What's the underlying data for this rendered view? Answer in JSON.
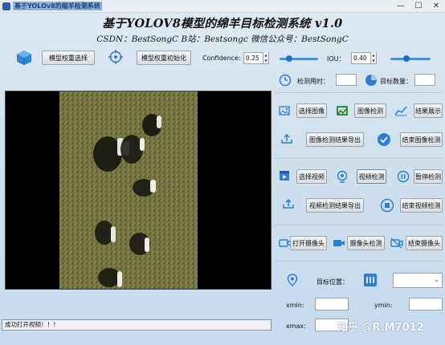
{
  "window": {
    "title": "基于YOLOv8的缩羊检测系统",
    "minimize": "—",
    "maximize": "☐",
    "close": "✕"
  },
  "header": {
    "title": "基于YOLOV8模型的绵羊目标检测系统 v1.0",
    "subtitle": "CSDN：BestSongC   B站：Bestsongc   微信公众号：BestSongC"
  },
  "toolbar": {
    "select_weights": "模型权重选择",
    "init_weights": "模型权重初始化",
    "confidence_label": "Confidence:",
    "confidence_value": "0.25",
    "confidence_level": 0.25,
    "iou_label": "IOU：",
    "iou_value": "0.40",
    "iou_level": 0.4
  },
  "stats": {
    "time_label": "检测用时：",
    "time_value": "",
    "count_label": "目标数量：",
    "count_value": ""
  },
  "image_section": {
    "select_image": "选择图像",
    "detect_image": "图像检测",
    "show_result": "结果展示",
    "export_image": "图像检测结果导出",
    "stop_image": "结束图像检测"
  },
  "video_section": {
    "select_video": "选择视频",
    "detect_video": "视频检测",
    "pause_detect": "暂停检测",
    "export_video": "视频检测结果导出",
    "stop_video": "结束视频检测"
  },
  "camera_section": {
    "open_camera": "打开摄像头",
    "detect_camera": "摄像头检测",
    "close_camera": "结束摄像头"
  },
  "target": {
    "position_label": "目标位置：",
    "select_value": "",
    "xmin_label": "xmin:",
    "ymin_label": "ymin:",
    "xmax_label": "xmax:",
    "xmin_value": "",
    "ymin_value": "",
    "xmax_value": ""
  },
  "status": {
    "message": "成功打开视频！！！"
  },
  "watermark": "知乎 @R.M7012",
  "colors": {
    "accent": "#1f6fc9",
    "icon_blue": "#2d7dd2"
  }
}
